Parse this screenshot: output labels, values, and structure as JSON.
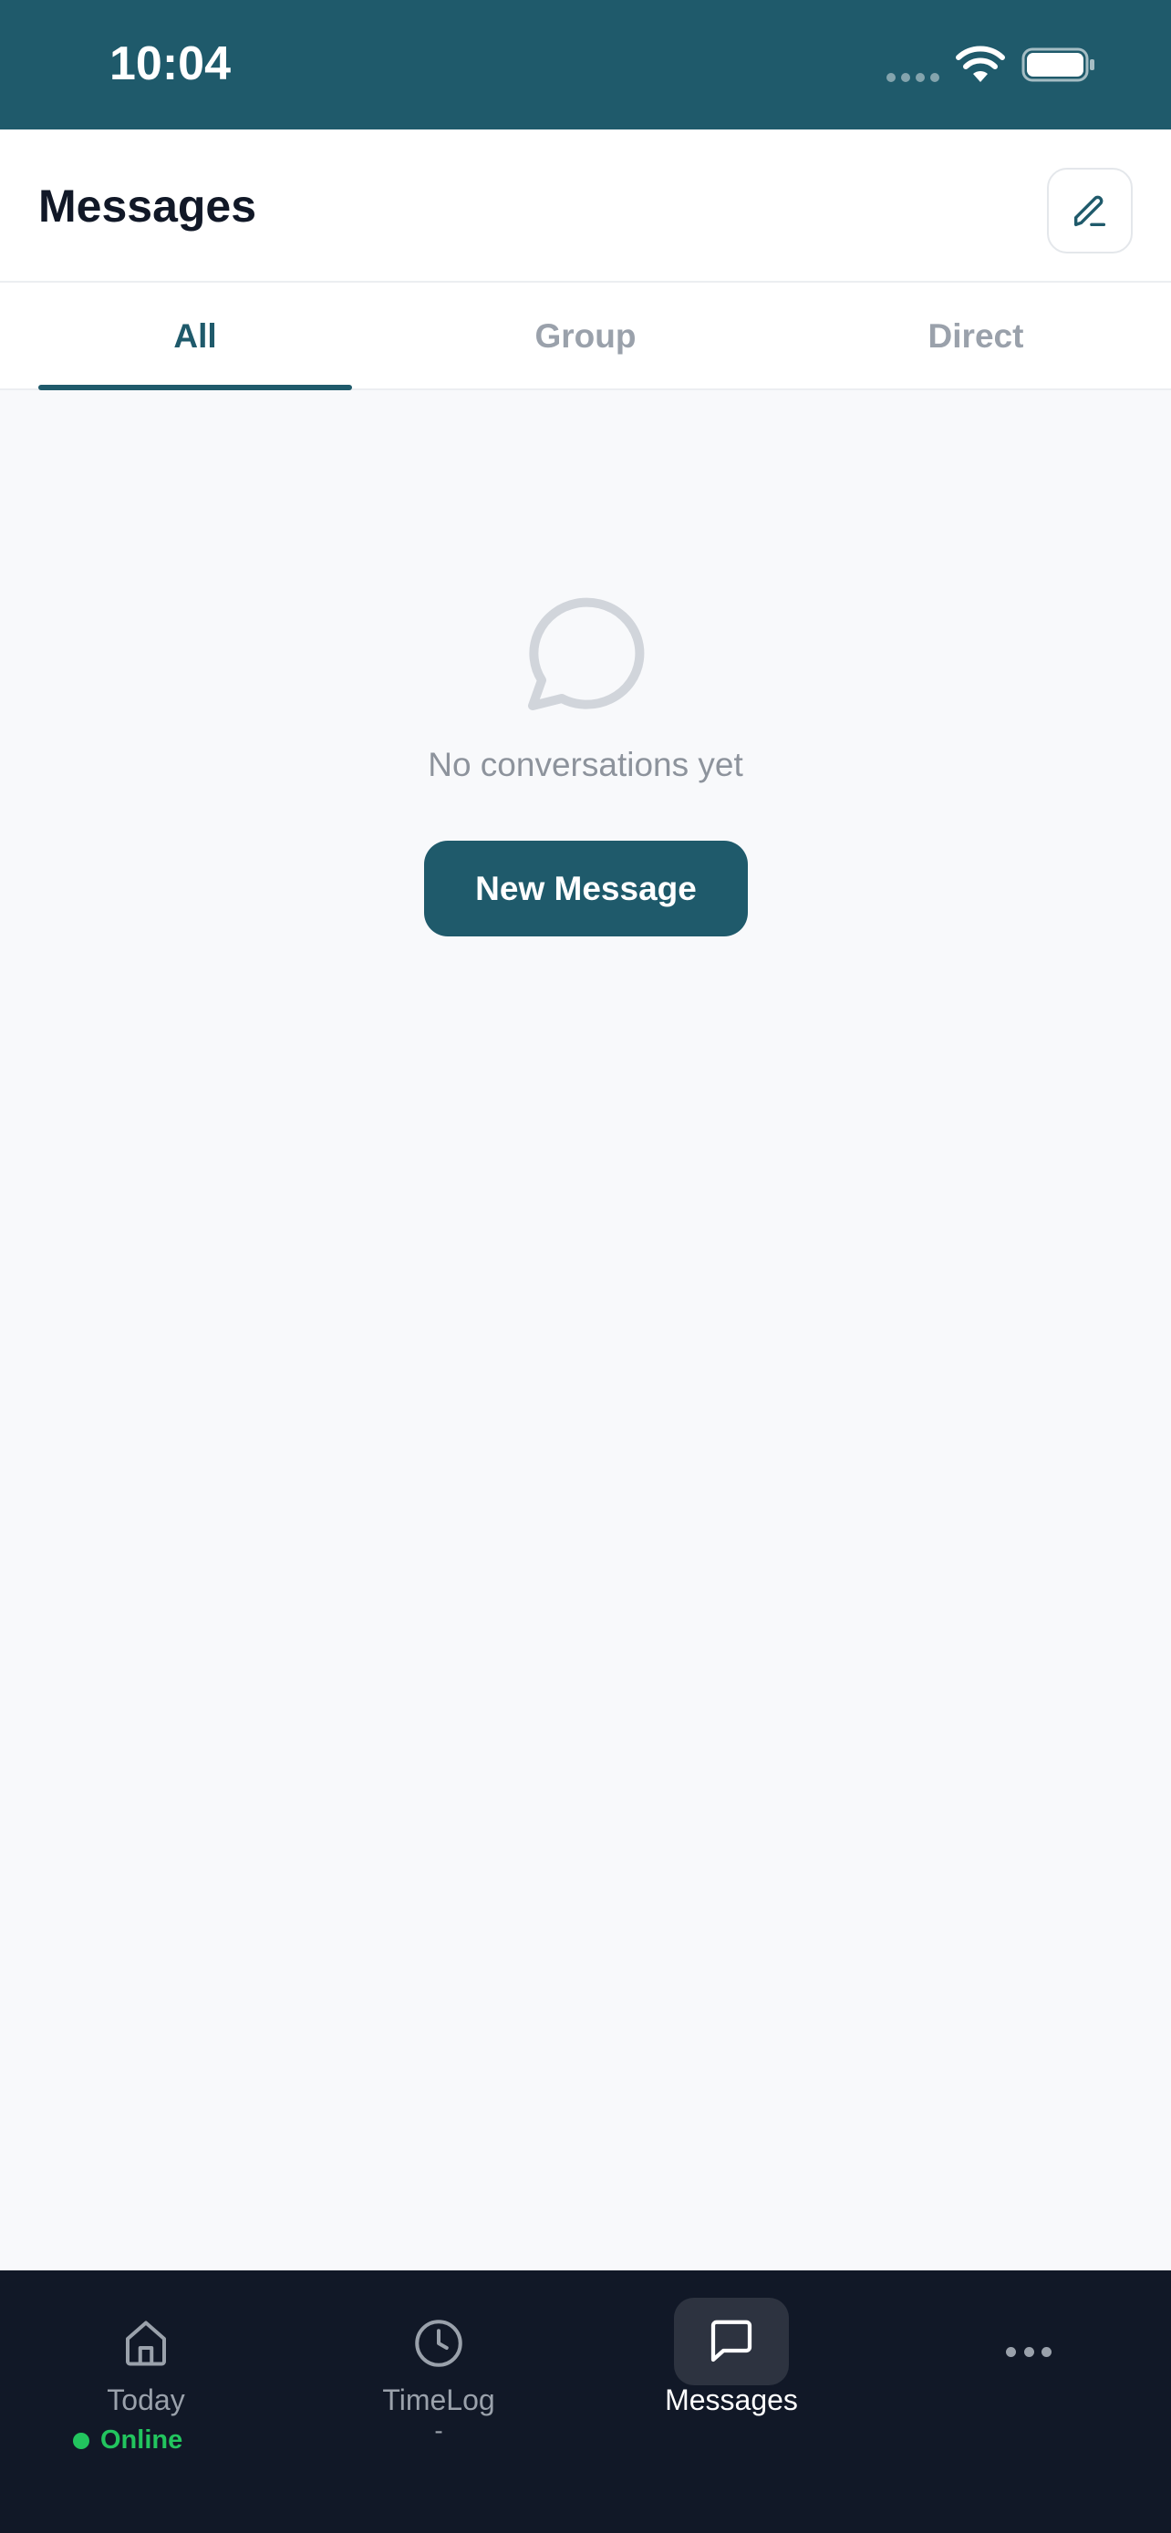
{
  "status_bar": {
    "time": "10:04",
    "icons": [
      "signal-icon",
      "wifi-icon",
      "battery-icon"
    ]
  },
  "header": {
    "title": "Messages",
    "compose_icon": "pencil-icon"
  },
  "tabs": [
    {
      "label": "All",
      "active": true
    },
    {
      "label": "Group",
      "active": false
    },
    {
      "label": "Direct",
      "active": false
    }
  ],
  "empty_state": {
    "icon": "chat-bubble-icon",
    "text": "No conversations yet",
    "button_label": "New Message"
  },
  "bottom_nav": {
    "items": [
      {
        "label": "Today",
        "icon": "home-icon",
        "status": "Online",
        "active": false
      },
      {
        "label": "TimeLog",
        "icon": "clock-icon",
        "sub": "-",
        "active": false
      },
      {
        "label": "Messages",
        "icon": "message-square-icon",
        "active": true
      },
      {
        "label": "",
        "icon": "more-icon",
        "active": false
      }
    ]
  },
  "colors": {
    "primary": "#1f5a6b",
    "nav_background": "#111827",
    "online": "#22c55e",
    "background": "#f8f9fb"
  }
}
